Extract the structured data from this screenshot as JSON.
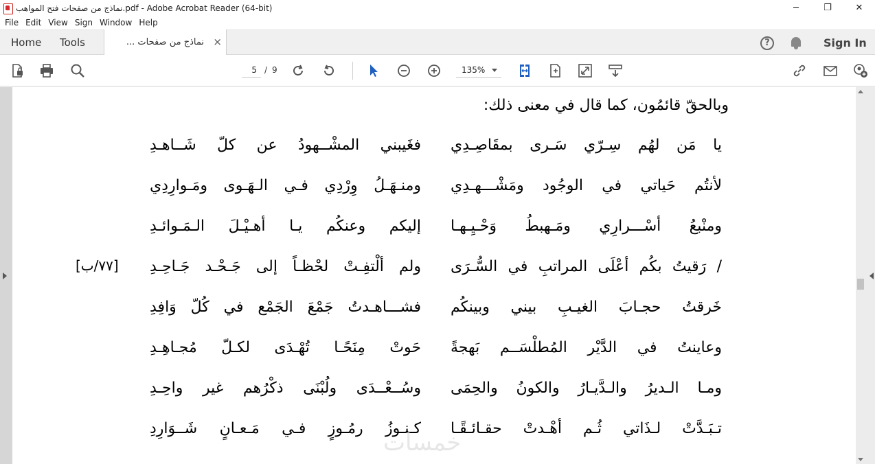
{
  "window": {
    "title": "نماذج من صفحات فتح المواهب.pdf - Adobe Acrobat Reader (64-bit)",
    "minimize": "─",
    "maximize": "❐",
    "close": "✕"
  },
  "menu": [
    "File",
    "Edit",
    "View",
    "Sign",
    "Window",
    "Help"
  ],
  "tabs": {
    "home": "Home",
    "tools": "Tools",
    "document": "نماذج من صفحات ...",
    "close": "×",
    "sign_in": "Sign In",
    "help": "?"
  },
  "toolbar": {
    "current_page": "5",
    "separator": "/",
    "total_pages": "9",
    "zoom": "135%"
  },
  "document": {
    "intro": "وبالحقّ قائمُون، كما قال في معنى ذلك:",
    "marker": "[٧٧/ب]",
    "verses": [
      {
        "right": "يا مَن لهُم سِـرّي سَـرى بمقَاصِـدِي",
        "left": "فغَيبني المشْــهودُ عن كلّ شَــاهـدِ"
      },
      {
        "right": "لأنتُم حَياتي في الوجُود ومَشْـــهـدِي",
        "left": "ومنـهَـلُ وِرْدِي فـي الـهَـوى ومَـوارِدِي"
      },
      {
        "right": "ومنْبعُ أسْـــرارِي ومَـهبطُ وَحْـيِـهـا",
        "left": "إليكم وعنكُم يـا أهـيْـلَ الـمَـوائـدِ"
      },
      {
        "right": "/ رَقيتُ بكُم أعْلَى المراتبِ في السُّـرَى",
        "left": "ولم ألْتفِـتْ لحْظـاً إلى جَـحْـد جَـاحِـدِ"
      },
      {
        "right": "خَرقتُ حجـابَ الغيـبِ بيني وبينكُم",
        "left": "فشـــاهـدتُ جَمْعَ الجَمْع في كُلّ وَافِدِ"
      },
      {
        "right": "وعاينتُ في الدَّيْر المُطلْسَــم بَهجةً",
        "left": "حَوتْ مِنَحًـا تُهْـدَى لكـلّ مُجـاهِـدِ"
      },
      {
        "right": "ومـا الـديرُ والـدَّيـارُ والكونُ والحِمَى",
        "left": "وسُــعْــدَى ولُبْنَى ذكْرُهم غير واحِـدِ"
      },
      {
        "right": "تـبَـدَّتْ لـذَاتي ثُـم أهْـدتْ حقـائـقًـا",
        "left": "كـنـوزُ رمُـوزٍ فـي مَـعـانٍ شَــوَارِدِ"
      }
    ],
    "watermark": "خمسات"
  }
}
